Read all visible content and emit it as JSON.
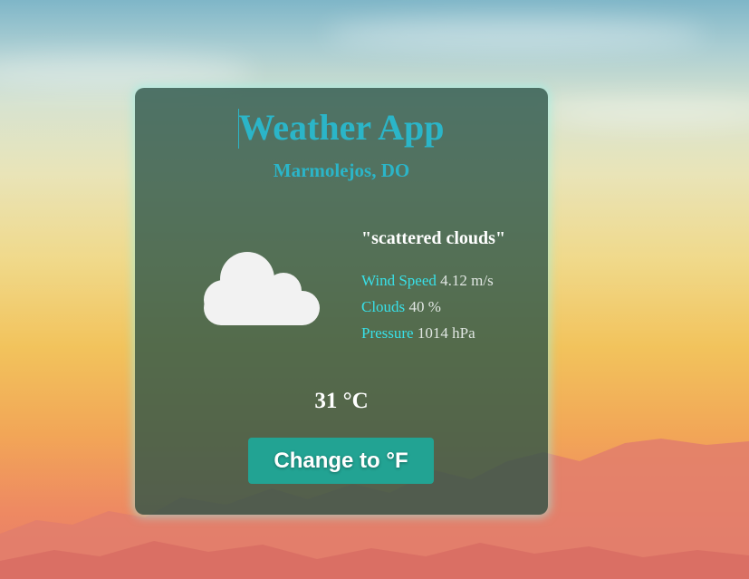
{
  "app": {
    "title": "Weather App",
    "location": "Marmolejos, DO"
  },
  "weather": {
    "description": "\"scattered clouds\"",
    "icon": "cloud-icon",
    "temperature": "31 °C",
    "details": [
      {
        "label": "Wind Speed",
        "value": "4.12 m/s"
      },
      {
        "label": "Clouds",
        "value": "40 %"
      },
      {
        "label": "Pressure",
        "value": "1014 hPa"
      }
    ]
  },
  "actions": {
    "toggle_unit_label": "Change to °F"
  },
  "colors": {
    "accent": "#2bb5c8",
    "detail_label": "#38e0e8",
    "button": "#22a393",
    "card": "#285246"
  }
}
